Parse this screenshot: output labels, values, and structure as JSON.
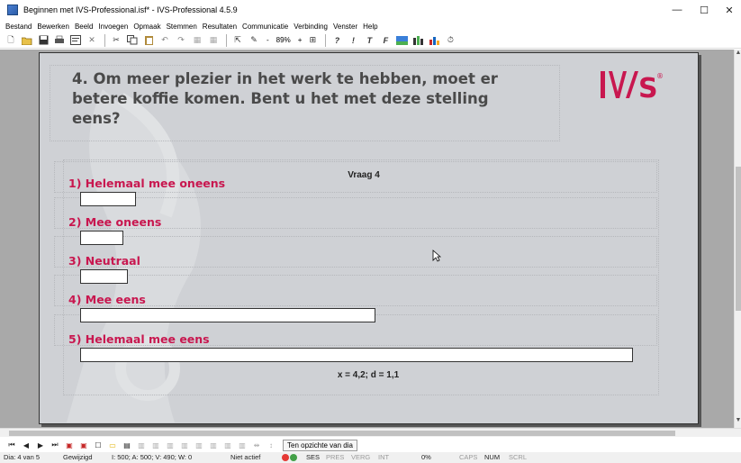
{
  "window": {
    "title": "Beginnen met IVS-Professional.isf* - IVS-Professional 4.5.9",
    "minimize": "—",
    "maximize": "☐",
    "close": "✕"
  },
  "menu": [
    "Bestand",
    "Bewerken",
    "Beeld",
    "Invoegen",
    "Opmaak",
    "Stemmen",
    "Resultaten",
    "Communicatie",
    "Verbinding",
    "Venster",
    "Help"
  ],
  "toolbar": {
    "zoom": "89%",
    "zoom_minus": "-",
    "zoom_plus": "+"
  },
  "slide": {
    "question": "4. Om meer plezier in het werk te hebben, moet er betere koffie komen. Bent u het met deze stelling eens?",
    "logo_text": "IVS",
    "logo_mark": "®",
    "colors": {
      "label": "#c8174f",
      "question": "#4a4a4a",
      "slide_bg": "#cfd1d5"
    }
  },
  "chart_data": {
    "type": "bar",
    "title": "Vraag 4",
    "categories": [
      "1) Helemaal mee oneens",
      "2) Mee oneens",
      "3) Neutraal",
      "4) Mee eens",
      "5) Helemaal mee eens"
    ],
    "values": [
      62,
      48,
      53,
      328,
      614
    ],
    "orientation": "horizontal",
    "stats": "x = 4,2; d = 1,1"
  },
  "navbar": {
    "overview_button": "Ten opzichte van dia"
  },
  "status": {
    "slide": "Dia: 4 van 5",
    "state": "Gewijzigd",
    "counts": "I: 500;  A: 500;  V: 490;  W: 0",
    "activity": "Niet actief",
    "ses": "SES",
    "pres": "PRES",
    "verg": "VERG",
    "int": "INT",
    "percent": "0%",
    "caps": "CAPS",
    "num": "NUM",
    "scrl": "SCRL"
  }
}
